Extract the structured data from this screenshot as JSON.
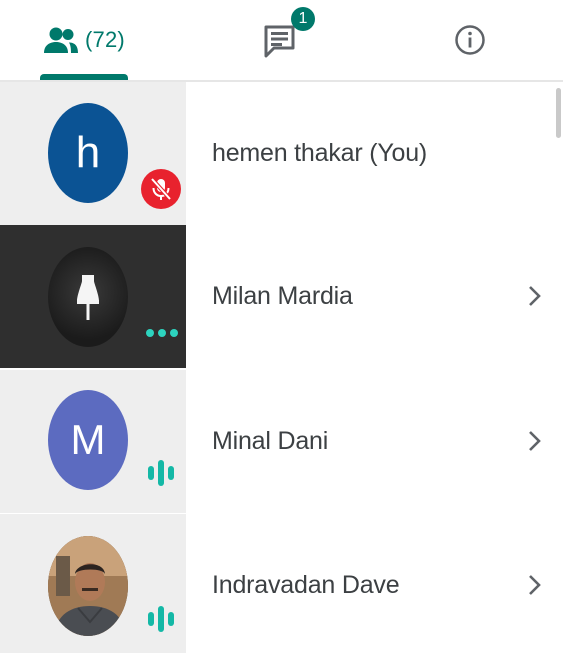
{
  "tabs": {
    "people": {
      "count_label": "(72)"
    },
    "chat": {
      "badge": "1"
    },
    "info": {}
  },
  "colors": {
    "accent": "#00796b",
    "mute_red": "#e8222e",
    "speaking_teal": "#2dd4bf"
  },
  "participants": [
    {
      "name": "hemen thakar (You)",
      "avatar_letter": "h",
      "avatar_color": "#0b5394",
      "status": "muted",
      "has_chevron": false
    },
    {
      "name": "Milan Mardia",
      "avatar_icon": "bell-icon",
      "status": "dots",
      "has_chevron": true
    },
    {
      "name": "Minal Dani",
      "avatar_letter": "M",
      "avatar_color": "#5c6bc0",
      "status": "speaking",
      "has_chevron": true
    },
    {
      "name": "Indravadan Dave",
      "avatar_icon": "person-photo",
      "status": "speaking",
      "has_chevron": true
    }
  ]
}
